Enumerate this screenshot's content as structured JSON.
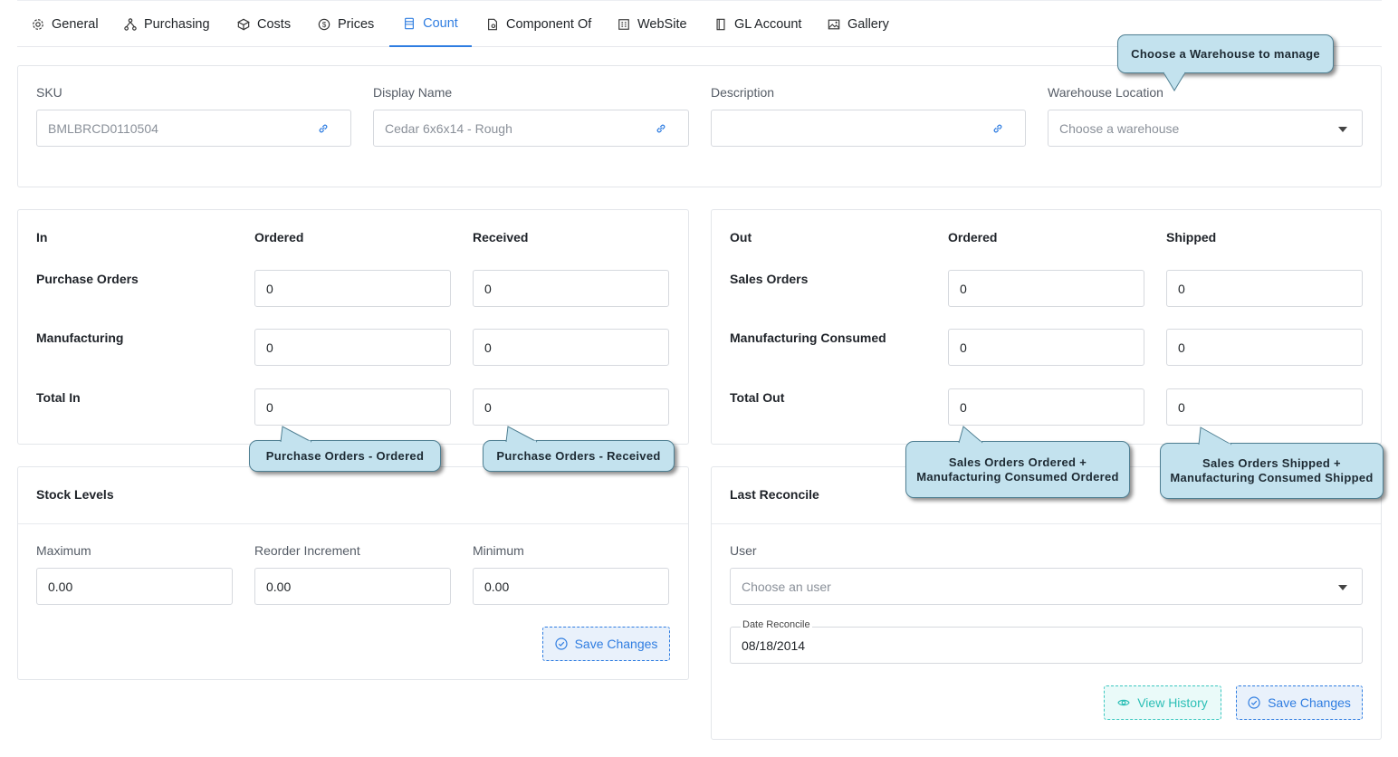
{
  "tabs": [
    {
      "label": "General",
      "icon": "gear-icon"
    },
    {
      "label": "Purchasing",
      "icon": "hierarchy-icon"
    },
    {
      "label": "Costs",
      "icon": "box-icon"
    },
    {
      "label": "Prices",
      "icon": "dollar-icon"
    },
    {
      "label": "Count",
      "icon": "list-icon",
      "active": true
    },
    {
      "label": "Component Of",
      "icon": "document-icon"
    },
    {
      "label": "WebSite",
      "icon": "grid-icon"
    },
    {
      "label": "GL Account",
      "icon": "book-icon"
    },
    {
      "label": "Gallery",
      "icon": "image-icon"
    }
  ],
  "header": {
    "sku_label": "SKU",
    "sku_value": "BMLBRCD0110504",
    "display_name_label": "Display Name",
    "display_name_value": "Cedar 6x6x14 - Rough",
    "description_label": "Description",
    "description_value": "",
    "warehouse_label": "Warehouse Location",
    "warehouse_placeholder": "Choose a warehouse"
  },
  "in_table": {
    "col_in": "In",
    "col_ordered": "Ordered",
    "col_received": "Received",
    "rows": [
      {
        "label": "Purchase Orders",
        "ordered": "0",
        "received": "0"
      },
      {
        "label": "Manufacturing",
        "ordered": "0",
        "received": "0"
      },
      {
        "label": "Total In",
        "ordered": "0",
        "received": "0"
      }
    ]
  },
  "out_table": {
    "col_out": "Out",
    "col_ordered": "Ordered",
    "col_shipped": "Shipped",
    "rows": [
      {
        "label": "Sales Orders",
        "ordered": "0",
        "shipped": "0"
      },
      {
        "label": "Manufacturing Consumed",
        "ordered": "0",
        "shipped": "0"
      },
      {
        "label": "Total Out",
        "ordered": "0",
        "shipped": "0"
      }
    ]
  },
  "stock_levels": {
    "title": "Stock Levels",
    "maximum_label": "Maximum",
    "maximum_value": "0.00",
    "reorder_label": "Reorder Increment",
    "reorder_value": "0.00",
    "minimum_label": "Minimum",
    "minimum_value": "0.00",
    "save_label": "Save Changes"
  },
  "last_reconcile": {
    "title": "Last Reconcile",
    "user_label": "User",
    "user_placeholder": "Choose an user",
    "date_label": "Date Reconcile",
    "date_value": "08/18/2014",
    "view_history_label": "View History",
    "save_label": "Save Changes"
  },
  "callouts": {
    "warehouse": "Choose a Warehouse to manage",
    "po_ordered": "Purchase Orders - Ordered",
    "po_received": "Purchase Orders - Received",
    "so_ordered_line1": "Sales Orders Ordered +",
    "so_ordered_line2": "Manufacturing Consumed Ordered",
    "so_shipped_line1": "Sales Orders Shipped +",
    "so_shipped_line2": "Manufacturing Consumed Shipped"
  },
  "colors": {
    "accent": "#2f7de1",
    "teal": "#2cbfb6",
    "callout_bg": "#c3e2ee"
  }
}
